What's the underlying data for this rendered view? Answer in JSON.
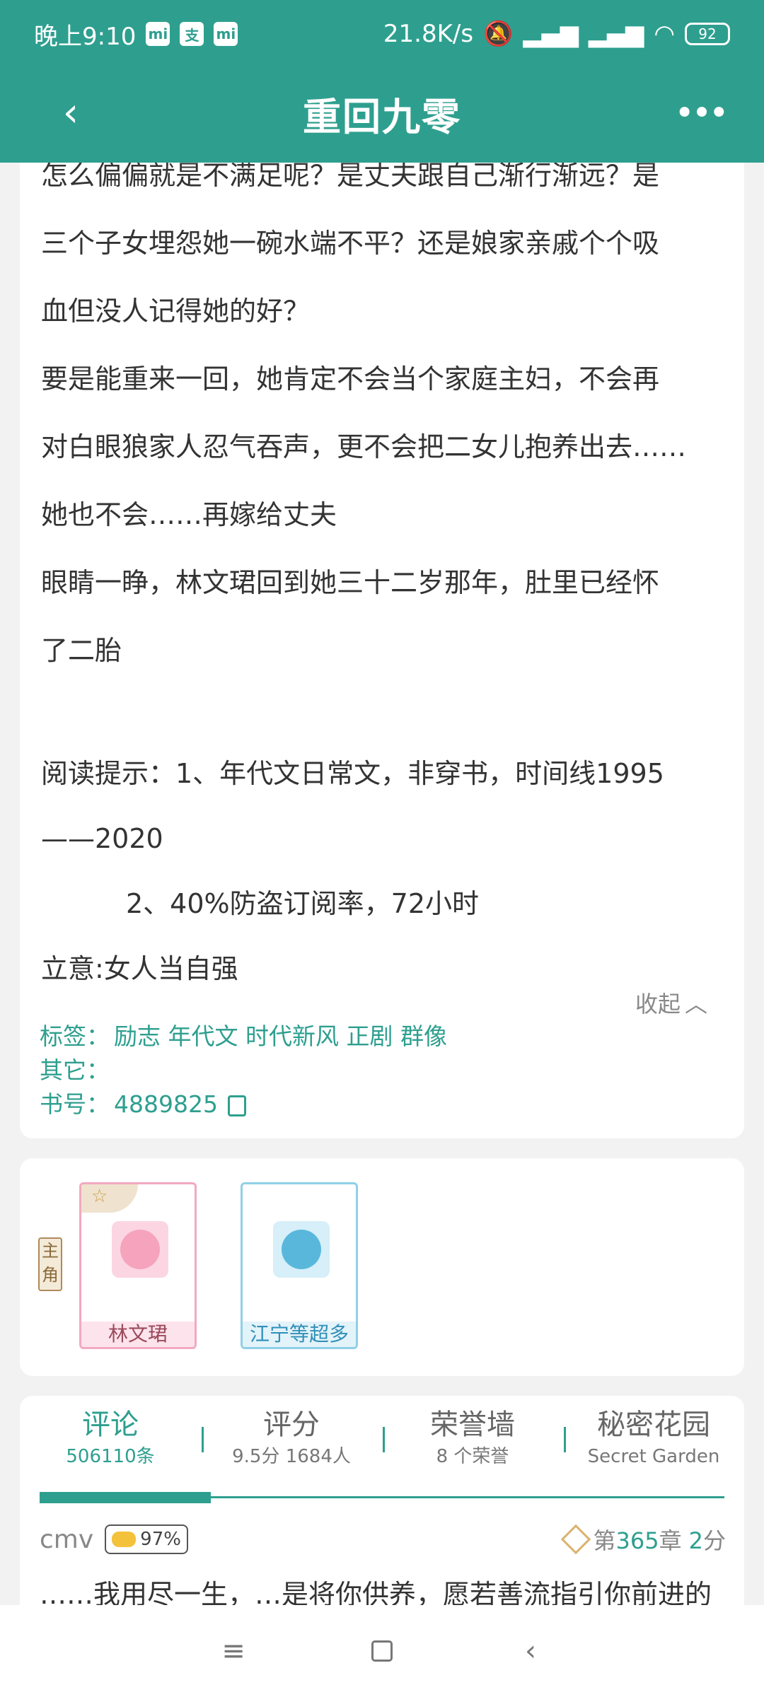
{
  "status_bar": {
    "time": "晚上9:10",
    "icons": [
      "mi-icon",
      "alipay-icon",
      "mi-icon"
    ],
    "net_speed": "21.8K/s",
    "battery": "92"
  },
  "app_bar": {
    "title": "重回九零",
    "back_icon": "back-arrow",
    "more_icon": "more-dots"
  },
  "synopsis": {
    "top_line": "怎么偏偏就是不满足呢？是丈夫跟自己渐行渐远？是",
    "lines": [
      "三个子女埋怨她一碗水端不平？还是娘家亲戚个个吸",
      "血但没人记得她的好？",
      "要是能重来一回，她肯定不会当个家庭主妇，不会再",
      "对白眼狼家人忍气吞声，更不会把二女儿抱养出去……",
      "她也不会……再嫁给丈夫",
      "眼睛一睁，林文珺回到她三十二岁那年，肚里已经怀",
      "了二胎",
      "",
      "阅读提示：1、年代文日常文，非穿书，时间线1995",
      "——2020"
    ],
    "indent_line": "2、40%防盗订阅率，72小时",
    "theme_line": "立意:女人当自强",
    "collapse_label": "收起",
    "tags_label": "标签：",
    "tags": "励志 年代文 时代新风 正剧 群像",
    "other_label": "其它：",
    "other": "",
    "book_id_label": "书号：",
    "book_id": "4889825"
  },
  "characters": {
    "role_tag": "主角",
    "items": [
      {
        "name": "林文珺"
      },
      {
        "name": "江宁等超多人"
      }
    ]
  },
  "tabs": [
    {
      "title": "评论",
      "sub": "506110条",
      "active": true
    },
    {
      "title": "评分",
      "sub": "9.5分 1684人",
      "active": false
    },
    {
      "title": "荣誉墙",
      "sub": "8 个荣誉",
      "active": false
    },
    {
      "title": "秘密花园",
      "sub": "Secret Garden",
      "active": false
    }
  ],
  "comment": {
    "user": "cmv",
    "badge": "97%",
    "chapter_prefix": "第",
    "chapter_num": "365",
    "chapter_suffix": "章",
    "score_num": "2",
    "score_suffix": "分",
    "text": "……我用尽一生，…是将你供养，愿若善流指引你前进的"
  },
  "colors": {
    "accent": "#2e9f8f",
    "background": "#f2f2f2"
  }
}
